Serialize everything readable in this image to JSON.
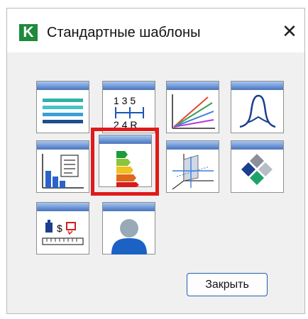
{
  "window": {
    "app_icon_letter": "K",
    "title": "Стандартные шаблоны",
    "close_glyph": "✕"
  },
  "templates": [
    {
      "icon": "colored-lines-icon"
    },
    {
      "icon": "gear-shift-icon",
      "labels_top": "1 3 5",
      "labels_bottom": "2 4 R"
    },
    {
      "icon": "line-chart-icon"
    },
    {
      "icon": "bell-curve-icon"
    },
    {
      "icon": "bar-report-icon"
    },
    {
      "icon": "energy-rating-icon",
      "selected": true
    },
    {
      "icon": "3d-axes-icon"
    },
    {
      "icon": "diamond-grid-icon"
    },
    {
      "icon": "measure-icon",
      "labels_top": "$"
    },
    {
      "icon": "person-icon"
    }
  ],
  "buttons": {
    "close_label": "Закрыть"
  },
  "colors": {
    "accent_red": "#e01a1a",
    "tile_header_blue": "#4d79c4",
    "app_icon_green": "#1f8a3b"
  }
}
